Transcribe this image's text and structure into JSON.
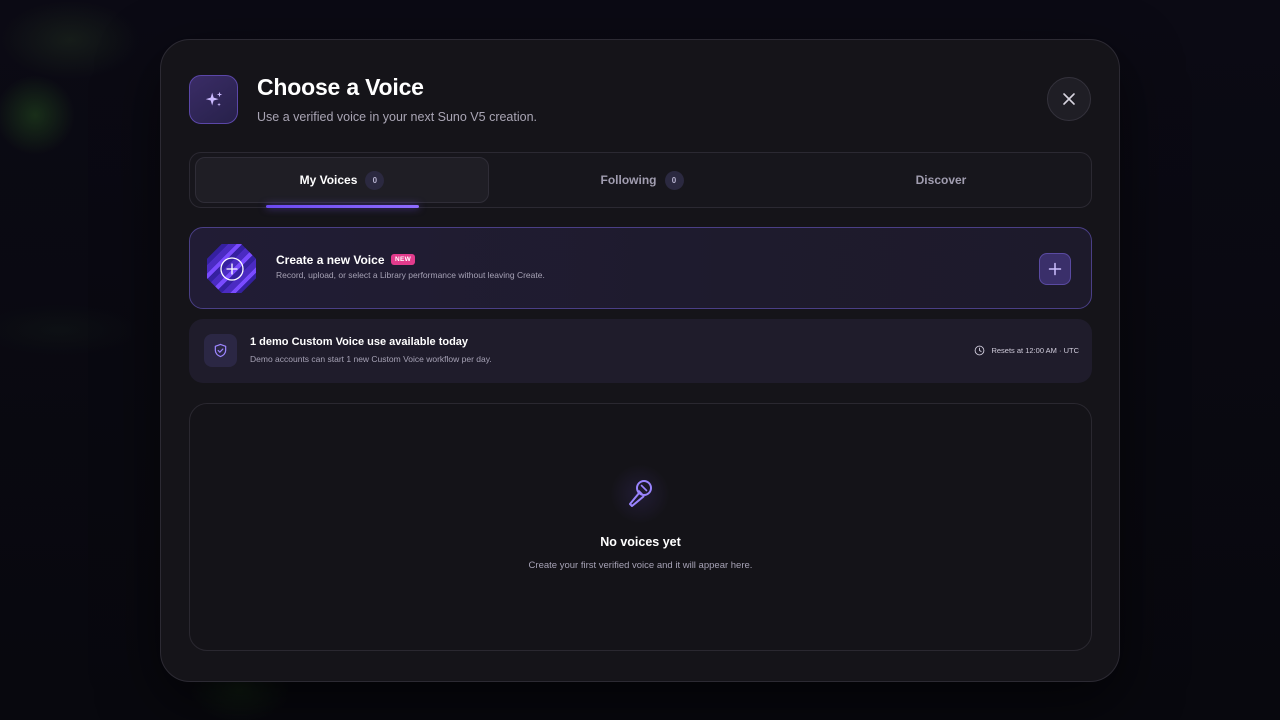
{
  "modal": {
    "title": "Choose a Voice",
    "subtitle": "Use a verified voice in your next Suno V5 creation.",
    "header_icon": "sparkles-icon",
    "close_icon": "close-icon"
  },
  "tabs": [
    {
      "label": "My Voices",
      "count": "0",
      "active": true
    },
    {
      "label": "Following",
      "count": "0",
      "active": false
    },
    {
      "label": "Discover",
      "active": false
    }
  ],
  "create_card": {
    "title": "Create a new Voice",
    "badge": "NEW",
    "description": "Record, upload, or select a Library performance without leaving Create.",
    "action_icon": "plus-icon"
  },
  "notice": {
    "title": "1 demo Custom Voice use available today",
    "description": "Demo accounts can start 1 new Custom Voice workflow per day.",
    "reset_text": "Resets at 12:00 AM · UTC",
    "icon": "shield-check-icon",
    "reset_icon": "clock-icon"
  },
  "empty_state": {
    "icon": "microphone-icon",
    "title": "No voices yet",
    "description": "Create your first verified voice and it will appear here."
  },
  "colors": {
    "accent": "#8e6cff",
    "badge": "#e23b8c",
    "modal_bg": "#151419"
  }
}
